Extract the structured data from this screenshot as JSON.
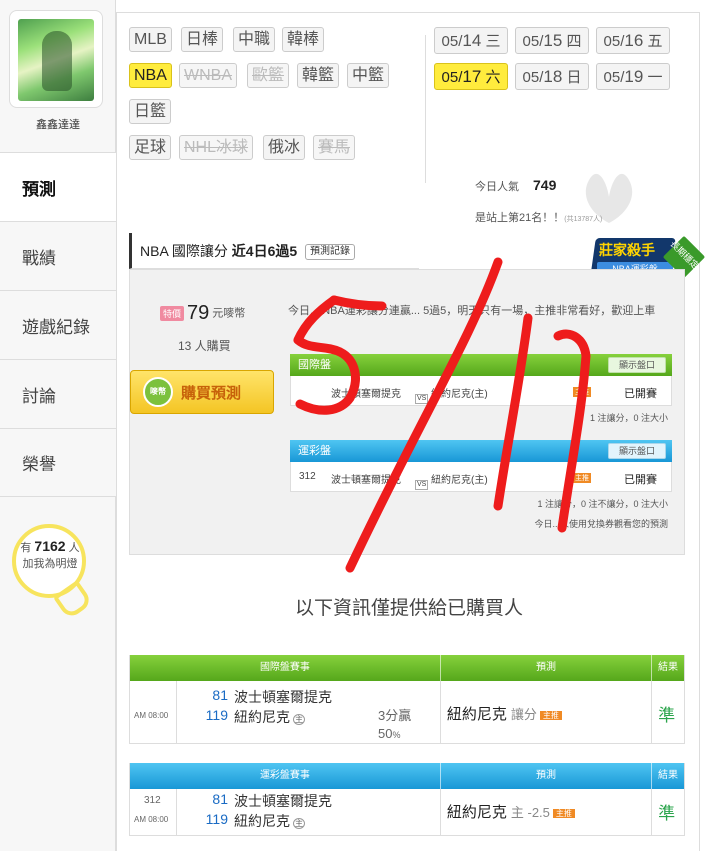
{
  "profile": {
    "username": "鑫鑫達達"
  },
  "nav": [
    {
      "label": "預測",
      "active": true
    },
    {
      "label": "戰績",
      "active": false
    },
    {
      "label": "遊戲紀錄",
      "active": false
    },
    {
      "label": "討論",
      "active": false
    },
    {
      "label": "榮譽",
      "active": false
    }
  ],
  "lamp": {
    "prefix": "有",
    "count": "7162",
    "suffix": "人",
    "line2": "加我為明燈"
  },
  "sports": {
    "row1": [
      "MLB",
      "日棒",
      "中職",
      "韓棒"
    ],
    "row2": [
      "NBA",
      "WNBA",
      "歐籃",
      "韓籃",
      "中籃"
    ],
    "row3": [
      "日籃"
    ],
    "row4": [
      "足球",
      "NHL冰球",
      "俄冰",
      "賽馬"
    ]
  },
  "dates": {
    "d1": {
      "md": "05/",
      "day": "14",
      "wd": "三"
    },
    "d2": {
      "md": "05/",
      "day": "15",
      "wd": "四"
    },
    "d3": {
      "md": "05/",
      "day": "16",
      "wd": "五"
    },
    "d4": {
      "md": "05/",
      "day": "17",
      "wd": "六"
    },
    "d5": {
      "md": "05/",
      "day": "18",
      "wd": "日"
    },
    "d6": {
      "md": "05/",
      "day": "19",
      "wd": "一"
    }
  },
  "stats": {
    "pop_label": "今日人氣",
    "pop_value": "749",
    "rank_text": "是站上第21名！！",
    "rank_small": "(共13787人)"
  },
  "section": {
    "title": "NBA 國際讓分",
    "streak": "近4日6過5",
    "record_btn": "預測記錄"
  },
  "badge": {
    "title": "莊家殺手",
    "sub": "NBA運彩盤",
    "ribbon": "長期穩定"
  },
  "pred": {
    "price_tag": "特價",
    "price": "79",
    "price_unit": "元嘜幣",
    "buyers": "13 人購買",
    "buy_coin": "嘜幣",
    "buy_label": "購買預測",
    "intro": "今日... NBA運彩讓分連贏... 5過5，明天只有一場，主推非常看好，歡迎上車",
    "intl": {
      "head": "國際盤",
      "show": "顯示盤口",
      "away": "波士頓塞爾提克",
      "vs": "VS",
      "home": "紐約尼克(主)",
      "tag": "主推",
      "status": "已開賽",
      "note": "1 注讓分，0 注大小"
    },
    "sport": {
      "head": "運彩盤",
      "show": "顯示盤口",
      "code": "312",
      "away": "波士頓塞爾提克",
      "vs": "VS",
      "home": "紐約尼克(主)",
      "tag": "主推",
      "status": "已開賽",
      "note": "1 注讓分，0 注不讓分，0 注大小",
      "note2": "今日...人使用兌換券觀看您的預測"
    }
  },
  "notice": "以下資訊僅提供給已購買人",
  "results": {
    "intl": {
      "head_event": "國際盤賽事",
      "head_pred": "預測",
      "head_result": "結果",
      "time": "AM 08:00",
      "away_score": "81",
      "away_team": "波士頓塞爾提克",
      "home_score": "119",
      "home_team": "紐約尼克",
      "home_mark": "主",
      "handicap1": "3分贏",
      "handicap2": "50",
      "handicap2_unit": "%",
      "pick_team": "紐約尼克",
      "pick_type": "讓分",
      "pick_tag": "主推",
      "result": "準"
    },
    "sport": {
      "head_event": "運彩盤賽事",
      "head_pred": "預測",
      "head_result": "結果",
      "code": "312",
      "time": "AM 08:00",
      "away_score": "81",
      "away_team": "波士頓塞爾提克",
      "home_score": "119",
      "home_team": "紐約尼克",
      "home_mark": "主",
      "pick_team": "紐約尼克",
      "pick_type": "主 -2.5",
      "pick_tag": "主推",
      "result": "準"
    }
  },
  "annotation": {
    "text": "5/17",
    "color": "#ee1c1c"
  },
  "colors": {
    "highlight": "#ffec3d",
    "green_head": "#55a71b",
    "blue_head": "#1897d6",
    "accurate": "#2aa44b"
  }
}
